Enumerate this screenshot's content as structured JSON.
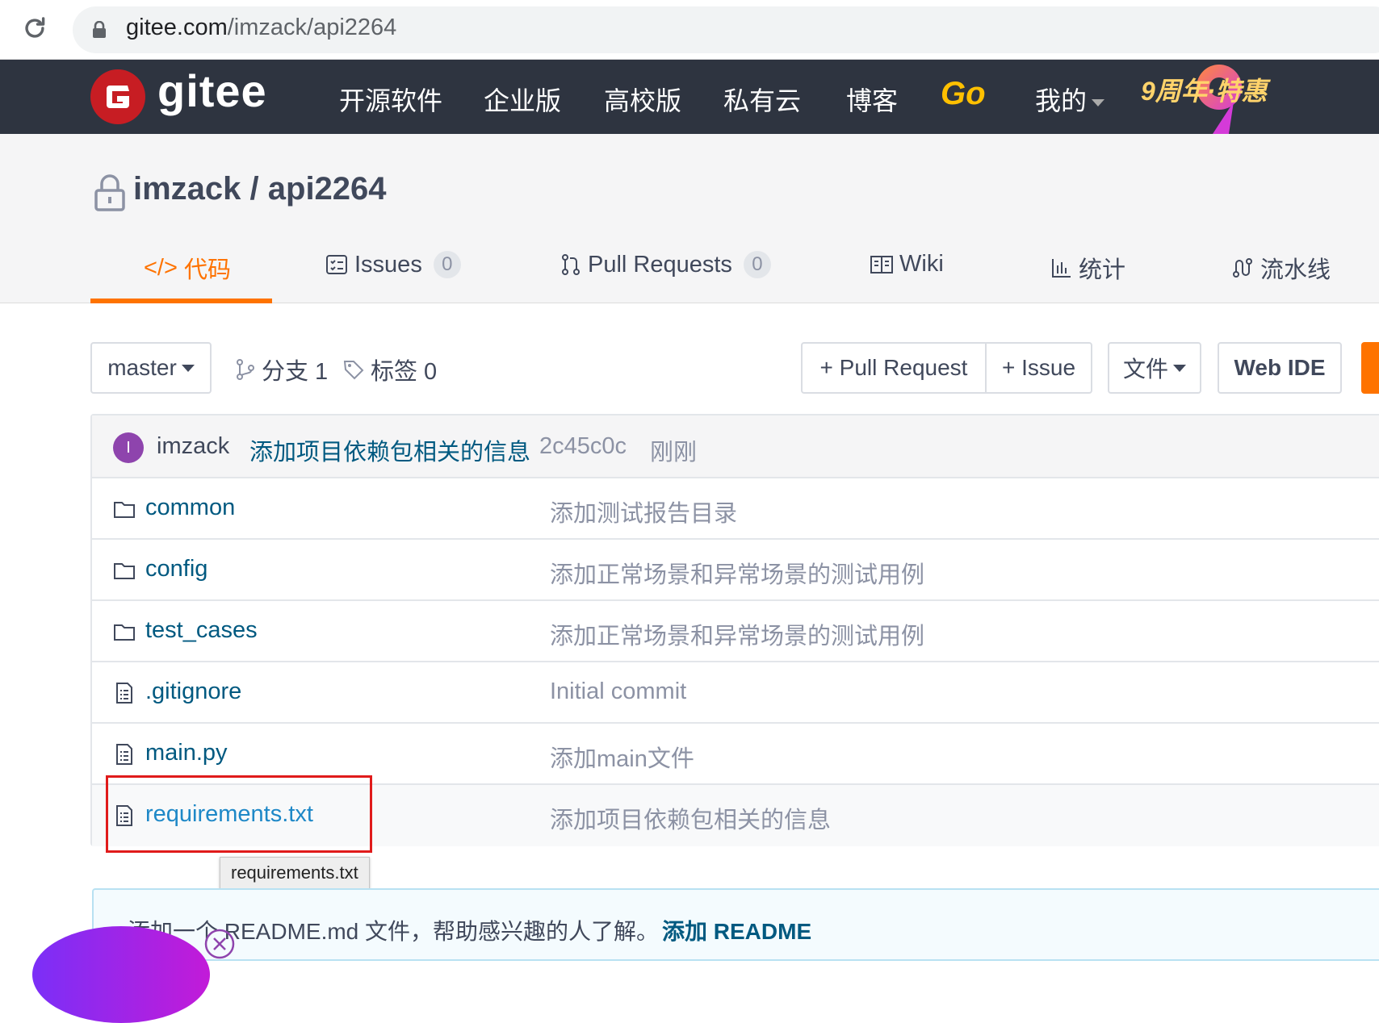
{
  "browser": {
    "url_host": "gitee.com",
    "url_path": "/imzack/api2264"
  },
  "nav": {
    "logo_text": "gitee",
    "items": [
      "开源软件",
      "企业版",
      "高校版",
      "私有云",
      "博客"
    ],
    "go_label": "Go",
    "mine_label": "我的",
    "promo_text": "9周年·特惠"
  },
  "project": {
    "title": "imzack / api2264",
    "tabs": [
      {
        "label": "代码",
        "icon": "code-icon"
      },
      {
        "label": "Issues",
        "count": "0",
        "icon": "issues-icon"
      },
      {
        "label": "Pull Requests",
        "count": "0",
        "icon": "pull-request-icon"
      },
      {
        "label": "Wiki",
        "icon": "wiki-icon"
      },
      {
        "label": "统计",
        "icon": "stats-icon"
      },
      {
        "label": "流水线",
        "icon": "pipeline-icon"
      }
    ]
  },
  "toolbar": {
    "branch_selector": "master",
    "branches": "分支 1",
    "tags": "标签 0",
    "pull_request_button": "+ Pull Request",
    "issue_button": "+ Issue",
    "file_button": "文件",
    "webide_button": "Web IDE"
  },
  "commit": {
    "avatar_letter": "I",
    "author": "imzack",
    "message": "添加项目依赖包相关的信息",
    "hash": "2c45c0c",
    "time": "刚刚"
  },
  "files": [
    {
      "name": "common",
      "type": "folder",
      "message": "添加测试报告目录"
    },
    {
      "name": "config",
      "type": "folder",
      "message": "添加正常场景和异常场景的测试用例"
    },
    {
      "name": "test_cases",
      "type": "folder",
      "message": "添加正常场景和异常场景的测试用例"
    },
    {
      "name": ".gitignore",
      "type": "file",
      "message": "Initial commit"
    },
    {
      "name": "main.py",
      "type": "file",
      "message": "添加main文件"
    },
    {
      "name": "requirements.txt",
      "type": "file",
      "message": "添加项目依赖包相关的信息"
    }
  ],
  "tooltip": "requirements.txt",
  "readme": {
    "notice": "添加一个 README.md 文件，帮助感兴趣的人了解。",
    "link": "添加 README"
  },
  "colors": {
    "header_bg": "#2e3440",
    "accent": "#fe7300",
    "link": "#005980",
    "highlight_box": "#e01b1b"
  }
}
